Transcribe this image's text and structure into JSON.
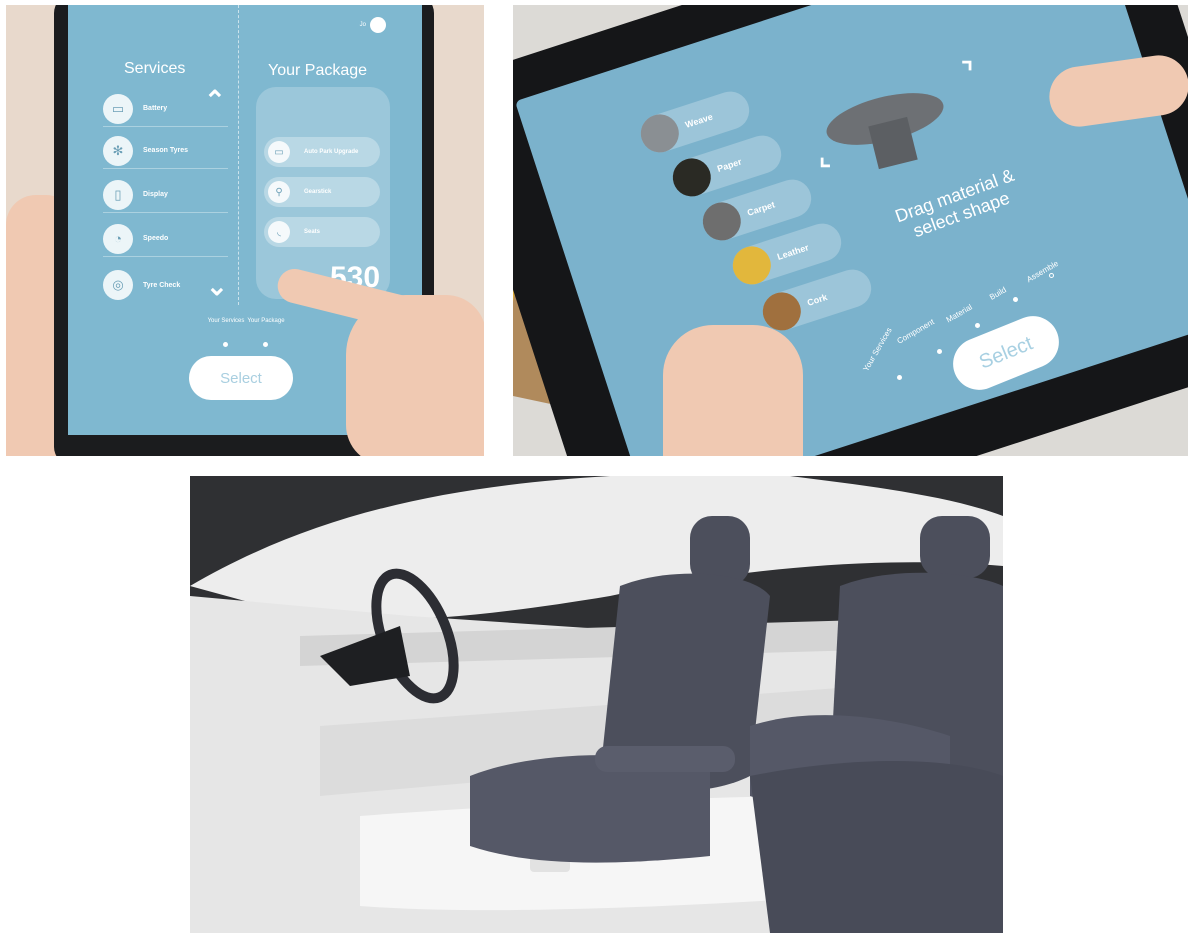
{
  "panel1": {
    "user_name": "Jo",
    "services_title": "Services",
    "package_title": "Your Package",
    "services": [
      {
        "label": "Battery",
        "icon": "battery-icon"
      },
      {
        "label": "Season Tyres",
        "icon": "snowflake-icon"
      },
      {
        "label": "Display",
        "icon": "display-icon"
      },
      {
        "label": "Speedo",
        "icon": "speedo-icon"
      },
      {
        "label": "Tyre Check",
        "icon": "tyre-icon"
      }
    ],
    "package_items": [
      {
        "label": "Auto Park Upgrade",
        "icon": "car-icon"
      },
      {
        "label": "Gearstick",
        "icon": "gearstick-icon"
      },
      {
        "label": "Seats",
        "icon": "seat-icon"
      }
    ],
    "price": "530",
    "steps": [
      "Your Services",
      "Your Package"
    ],
    "select_label": "Select"
  },
  "panel2": {
    "materials": [
      {
        "label": "Weave",
        "color": "#8a8f93"
      },
      {
        "label": "Paper",
        "color": "#2a2a24"
      },
      {
        "label": "Carpet",
        "color": "#6e6e6e"
      },
      {
        "label": "Leather",
        "color": "#e2b73c"
      },
      {
        "label": "Cork",
        "color": "#a0703e"
      }
    ],
    "instruction_line1": "Drag material &",
    "instruction_line2": "select shape",
    "steps": [
      "Your Services",
      "Component",
      "Material",
      "Build",
      "Assemble"
    ],
    "select_label": "Select"
  },
  "colors": {
    "screen_blue": "#7fb8d0",
    "seat_fabric": "#4c4f5c",
    "interior_white": "#eeeeee"
  }
}
